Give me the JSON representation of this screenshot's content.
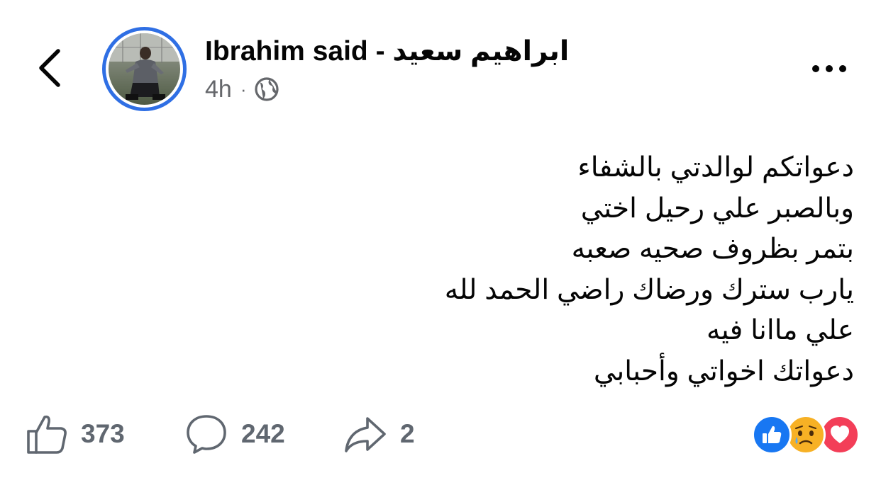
{
  "header": {
    "back_icon": "chevron-left-icon",
    "author_name": "Ibrahim said - ابراهيم سعيد",
    "time": "4h",
    "separator": "·",
    "audience_icon": "globe-icon",
    "more_icon": "more-horizontal-icon"
  },
  "post": {
    "lines": [
      "دعواتكم لوالدتي بالشفاء",
      "وبالصبر علي رحيل اختي",
      "بتمر بظروف صحيه صعبه",
      "يارب سترك ورضاك راضي الحمد لله",
      "علي ماانا فيه",
      "دعواتك اخواتي وأحبابي"
    ]
  },
  "actions": {
    "likes": "373",
    "comments": "242",
    "shares": "2"
  },
  "reactions": [
    "like",
    "sad",
    "love"
  ],
  "colors": {
    "avatar_ring": "#2f6fe4",
    "like_blue": "#1877f2",
    "love_red": "#f33e58",
    "sad_yellow": "#f7b125",
    "muted_text": "#65676b"
  }
}
